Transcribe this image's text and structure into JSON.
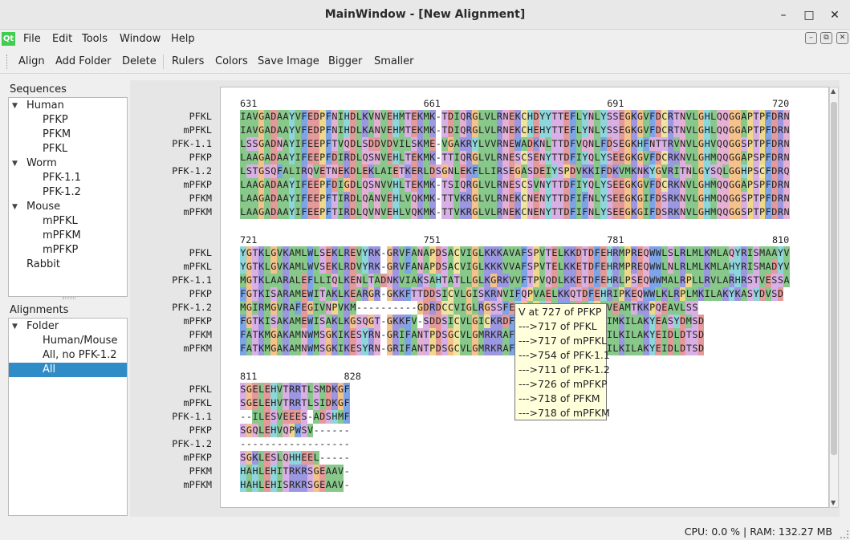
{
  "window": {
    "title": "MainWindow - [New Alignment]"
  },
  "menu": [
    "File",
    "Edit",
    "Tools",
    "Window",
    "Help"
  ],
  "toolbar": {
    "group1": [
      "Align",
      "Add Folder",
      "Delete"
    ],
    "group2": [
      "Rulers",
      "Colors",
      "Save Image",
      "Bigger",
      "Smaller"
    ]
  },
  "sequences_panel": {
    "label": "Sequences",
    "items": [
      {
        "label": "Human",
        "level": 0,
        "expanded": true
      },
      {
        "label": "PFKP",
        "level": 1
      },
      {
        "label": "PFKM",
        "level": 1
      },
      {
        "label": "PFKL",
        "level": 1
      },
      {
        "label": "Worm",
        "level": 0,
        "expanded": true
      },
      {
        "label": "PFK-1.1",
        "level": 1
      },
      {
        "label": "PFK-1.2",
        "level": 1
      },
      {
        "label": "Mouse",
        "level": 0,
        "expanded": true
      },
      {
        "label": "mPFKL",
        "level": 1
      },
      {
        "label": "mPFKM",
        "level": 1
      },
      {
        "label": "mPFKP",
        "level": 1
      },
      {
        "label": "Rabbit",
        "level": 0
      }
    ]
  },
  "alignments_panel": {
    "label": "Alignments",
    "items": [
      {
        "label": "Folder",
        "level": 0,
        "expanded": true
      },
      {
        "label": "Human/Mouse",
        "level": 1
      },
      {
        "label": "All, no PFK-1.2",
        "level": 1
      },
      {
        "label": "All",
        "level": 1,
        "selected": true
      }
    ]
  },
  "alignment": {
    "names": [
      "PFKL",
      "mPFKL",
      "PFK-1.1",
      "PFKP",
      "PFK-1.2",
      "mPFKP",
      "PFKM",
      "mPFKM"
    ],
    "blocks": [
      {
        "ruler": [
          {
            "num": "631",
            "col": 0
          },
          {
            "num": "661",
            "col": 30
          },
          {
            "num": "691",
            "col": 60
          },
          {
            "num": "720",
            "col": 87
          }
        ],
        "rows": [
          "IAVGADAAYVFEDPFNIHDLKVNVEHMTEKMK-TDIQRGLVLRNEKCHDYYTTEFLYNLYSSEGKGVFDCRTNVLGHLQQGGAPTPFDRN",
          "IAVGADAAYVFEDPFNIHDLKANVEHMTEKMK-TDIQRGLVLRNEKCHEHYTTEFLYNLYSSEGKGVFDCRTNVLGHLQQGGAPTPFDRN",
          "LSSGADNAYIFEEPFTVQDLSDDVDVILSKME-VGAKRYLVVRNEWADKNLTTDFVQNLFDSEGKHFNTTRVNVLGHVQQGGSPTPFDRN",
          "LAAGADAAYIFEEPFDIRDLQSNVEHLTEKMK-TTIQRGLVLRNESCSENYTTDFIYQLYSEEGKGVFDCRKNVLGHMQQGGAPSPFDRN",
          "LSTGSQFALIRQVETNEKDLEKLAIETKERLDSGNLEKFLLIRSEGASDEIYSPDVKKIFDKVMKNKYGVRITNLGYSQLGGHPSCFDRQ",
          "LAAGADAAYIFEEPFDIGDLQSNVVHLTEKMK-TSIQRGLVLRNESCSVNYTTDFIYQLYSEEGKGVFDCRKNVLGHMQQGGAPSPFDRN",
          "LAAGADAAYIFEEPFTIRDLQANVEHLVQKMK-TTVKRGLVLRNEKCNENYTTDFIFNLYSEEGKGIFDSRKNVLGHMQQGGSPTPFDRN",
          "LAAGADAAYIFEEPFTIRDLQVNVEHLVQKMK-TTVKRGLVLRNEKCNENYTTDFIFNLYSEEGKGIFDSRKNVLGHMQQGGSPTPFDRN"
        ]
      },
      {
        "ruler": [
          {
            "num": "721",
            "col": 0
          },
          {
            "num": "751",
            "col": 30
          },
          {
            "num": "781",
            "col": 60
          },
          {
            "num": "810",
            "col": 87
          }
        ],
        "rows": [
          "YGTKLGVKAMLWLSEKLREVYRK-GRVFANAPDSACVIGLKKKAVAFSPVTELKKDTDFEHRMPREQWWLSLRLMLKMLAQYRISMAAYV",
          "YGTKLGVKAMLWVSEKLRDVYRK-GRVFANAPDSACVIGLKKKVVAFSPVTELKKETDFEHRMPREQWWLNLRLMLKMLAHYRISMADYV",
          "MGTKLAARALEFLLIQLKENLTADNKVIAKSAHTATLLGLKGRKVVFTPVQDLKKETDFEHRLPSEQWWMALRPLLRVLARHRSTVESSA",
          "FGTKISARAMEWITAKLKEARGR-GKKFTTDDSICVLGISKRNVIFQPVAELKKQTDFEHRIPKEQWWLKLRPLMKILAKYKASYDVSD",
          "MGIRMGVRAFEGIVNPVKM----------GDRDCCVIGLRGSSFEHGVPHNMWWLDLHPLVEAMTKKPQEAVLSS",
          "FGTKISAKAMEWISAKLKGSQGT-GKKFV-SDDSICVLGICKRDFEHRIPKEQWWLKLRPIMKILAKYEASYDMSD",
          "FATKMGAKAMNWMSGKIKESYRN-GRIFANTPDSGCVLGMRKRAFEHRIPKEQWWLKLRPILKILAKYEIDLDTSD",
          "FATKMGAKAMNWMSGKIKESYRN-GRIFANTPDSGCVLGMRKRAFEHRIPKEQWWLKLRPILKILAKYEIDLDTSD"
        ]
      },
      {
        "ruler": [
          {
            "num": "811",
            "col": 0
          },
          {
            "num": "828",
            "col": 17
          }
        ],
        "rows": [
          "SGELEHVTRRTLSMDKGF",
          "SGELEHVTRRTLSIDKGF",
          "--ILESVEEES-ADSHMF",
          "SGQLEHVQPWSV------",
          "------------------",
          "SGKLESLQHHEEL-----",
          "HAHLEHITRKRSGEAAV-",
          "HAHLEHISRKRSGEAAV-"
        ]
      }
    ]
  },
  "tooltip": {
    "lines": [
      "V at 727 of PFKP",
      "--->717 of PFKL",
      "--->717 of mPFKL",
      "--->754 of PFK-1.1",
      "--->711 of PFK-1.2",
      "--->726 of mPFKP",
      "--->718 of PFKM",
      "--->718 of mPFKM"
    ]
  },
  "status": {
    "text": "CPU: 0.0 % | RAM: 132.27 MB"
  }
}
